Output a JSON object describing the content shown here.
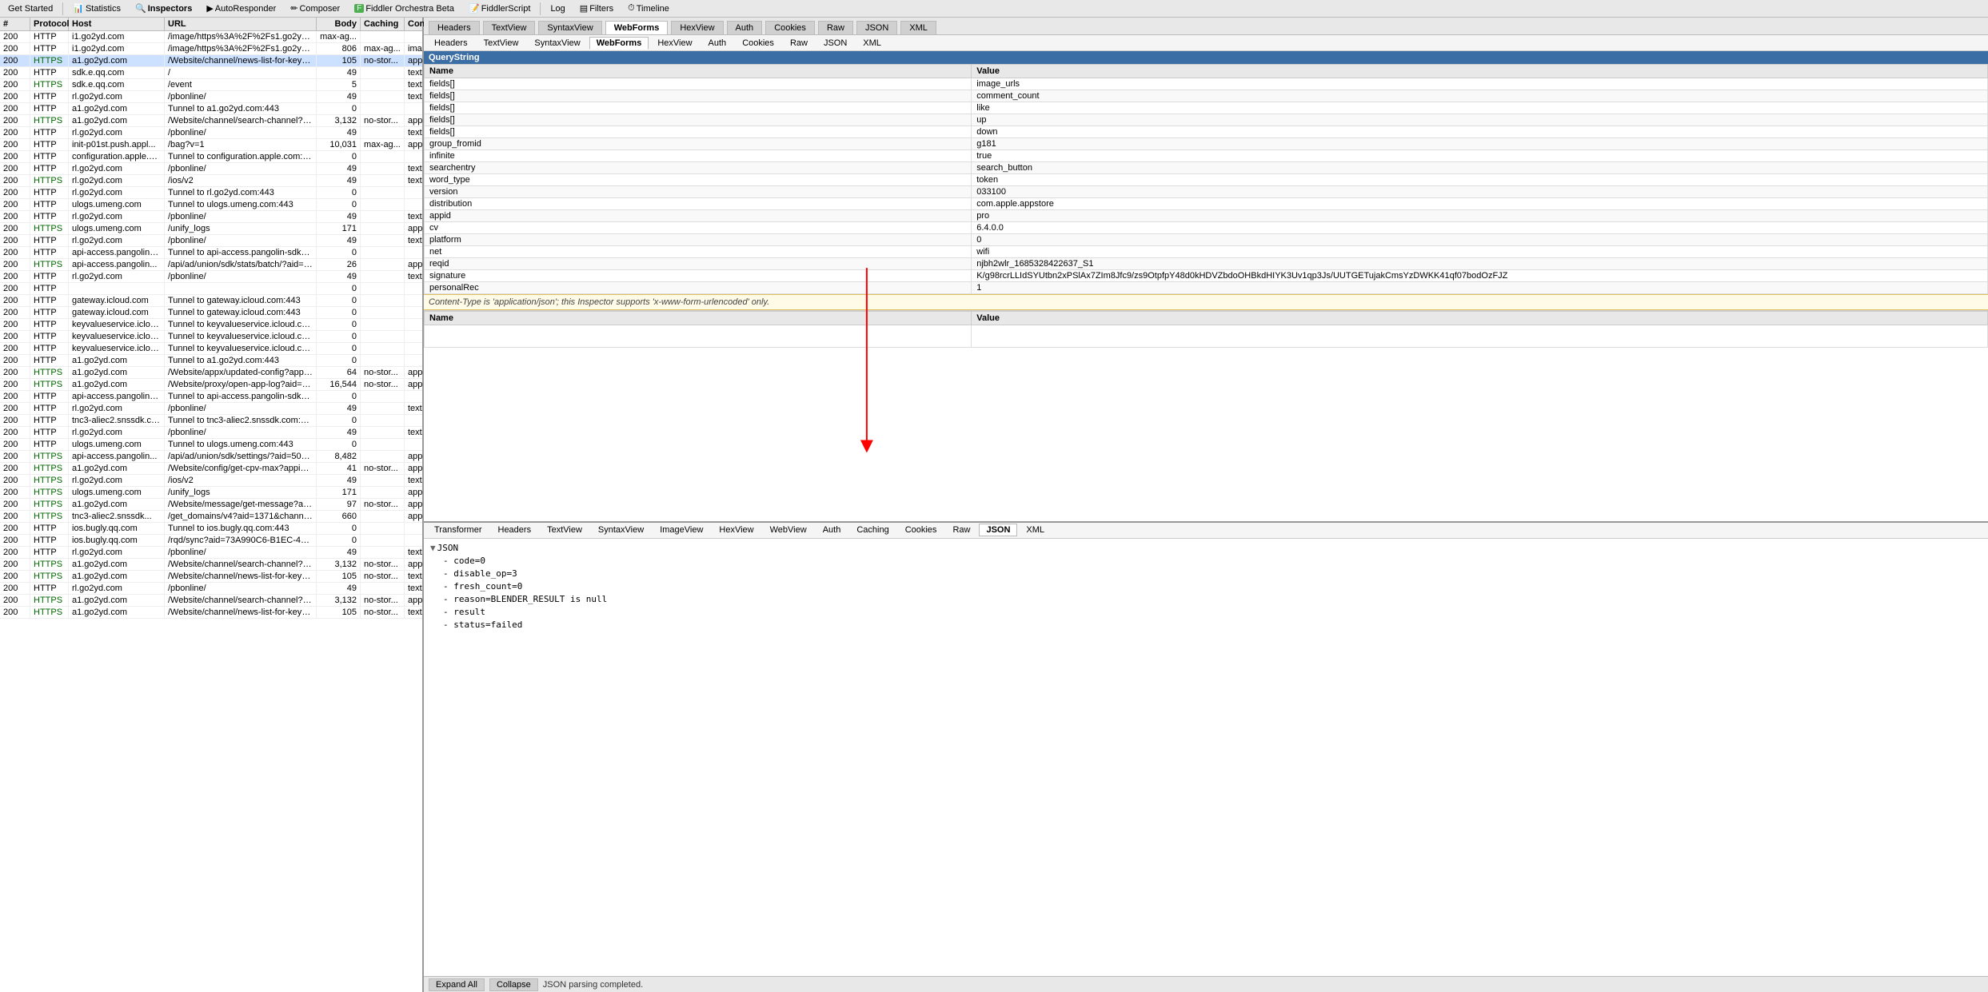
{
  "toolbar": {
    "get_started": "Get Started",
    "statistics": "Statistics",
    "inspectors": "Inspectors",
    "autoresponder": "AutoResponder",
    "composer": "Composer",
    "fiddler_orchestra": "Fiddler Orchestra Beta",
    "fiddler_script": "FiddlerScript",
    "log": "Log",
    "filters": "Filters",
    "timeline": "Timeline"
  },
  "traffic_columns": {
    "result": "#",
    "protocol": "Protocol",
    "host": "Host",
    "url": "URL",
    "body": "Body",
    "caching": "Caching",
    "content_type": "Content-Ty"
  },
  "traffic_rows": [
    {
      "result": "200",
      "protocol": "HTTP",
      "host": "i1.go2yd.com",
      "url": "/image/https%3A%2F%2Fs1.go2yd.com%2Fget-i...",
      "body": "max-ag...",
      "caching": "",
      "content_type": ""
    },
    {
      "result": "200",
      "protocol": "HTTP",
      "host": "i1.go2yd.com",
      "url": "/image/https%3A%2F%2Fs1.go2yd.com%2Fget-i...",
      "body": "806",
      "caching": "max-ag...",
      "content_type": "image/web"
    },
    {
      "result": "200",
      "protocol": "HTTPS",
      "host": "a1.go2yd.com",
      "url": "/Website/channel/news-list-for-keyword?cend=30&...",
      "body": "105",
      "caching": "no-stor...",
      "content_type": "application,"
    },
    {
      "result": "200",
      "protocol": "HTTP",
      "host": "sdk.e.qq.com",
      "url": "/",
      "body": "49",
      "caching": "",
      "content_type": "text/plain;"
    },
    {
      "result": "200",
      "protocol": "HTTPS",
      "host": "sdk.e.qq.com",
      "url": "/event",
      "body": "5",
      "caching": "",
      "content_type": "text/plain;"
    },
    {
      "result": "200",
      "protocol": "HTTP",
      "host": "rl.go2yd.com",
      "url": "/pbonline/",
      "body": "49",
      "caching": "",
      "content_type": "text/plain;"
    },
    {
      "result": "200",
      "protocol": "HTTP",
      "host": "a1.go2yd.com",
      "url": "Tunnel to a1.go2yd.com:443",
      "body": "0",
      "caching": "",
      "content_type": ""
    },
    {
      "result": "200",
      "protocol": "HTTPS",
      "host": "a1.go2yd.com",
      "url": "/Website/channel/search-channel?appid=pro&cv=6...",
      "body": "3,132",
      "caching": "no-stor...",
      "content_type": "application,"
    },
    {
      "result": "200",
      "protocol": "HTTP",
      "host": "rl.go2yd.com",
      "url": "/pbonline/",
      "body": "49",
      "caching": "",
      "content_type": "text/plain;"
    },
    {
      "result": "200",
      "protocol": "HTTP",
      "host": "init-p01st.push.appl...",
      "url": "/bag?v=1",
      "body": "10,031",
      "caching": "max-ag...",
      "content_type": "application,"
    },
    {
      "result": "200",
      "protocol": "HTTP",
      "host": "configuration.apple.com",
      "url": "Tunnel to configuration.apple.com:443",
      "body": "0",
      "caching": "",
      "content_type": ""
    },
    {
      "result": "200",
      "protocol": "HTTP",
      "host": "rl.go2yd.com",
      "url": "/pbonline/",
      "body": "49",
      "caching": "",
      "content_type": "text/plain;"
    },
    {
      "result": "200",
      "protocol": "HTTPS",
      "host": "rl.go2yd.com",
      "url": "/ios/v2",
      "body": "49",
      "caching": "",
      "content_type": "text/plain;"
    },
    {
      "result": "200",
      "protocol": "HTTP",
      "host": "rl.go2yd.com",
      "url": "Tunnel to rl.go2yd.com:443",
      "body": "0",
      "caching": "",
      "content_type": ""
    },
    {
      "result": "200",
      "protocol": "HTTP",
      "host": "ulogs.umeng.com",
      "url": "Tunnel to ulogs.umeng.com:443",
      "body": "0",
      "caching": "",
      "content_type": ""
    },
    {
      "result": "200",
      "protocol": "HTTP",
      "host": "rl.go2yd.com",
      "url": "/pbonline/",
      "body": "49",
      "caching": "",
      "content_type": "text/plain;"
    },
    {
      "result": "200",
      "protocol": "HTTPS",
      "host": "ulogs.umeng.com",
      "url": "/unify_logs",
      "body": "171",
      "caching": "",
      "content_type": "application,"
    },
    {
      "result": "200",
      "protocol": "HTTP",
      "host": "rl.go2yd.com",
      "url": "/pbonline/",
      "body": "49",
      "caching": "",
      "content_type": "text/plain;"
    },
    {
      "result": "200",
      "protocol": "HTTP",
      "host": "api-access.pangolin-sdk-toutiao.com",
      "url": "Tunnel to api-access.pangolin-sdk-toutiao.com:443",
      "body": "0",
      "caching": "",
      "content_type": ""
    },
    {
      "result": "200",
      "protocol": "HTTPS",
      "host": "api-access.pangolin...",
      "url": "/api/ad/union/sdk/stats/batch/?aid=5000546&versi...",
      "body": "26",
      "caching": "",
      "content_type": "application,"
    },
    {
      "result": "200",
      "protocol": "HTTP",
      "host": "rl.go2yd.com",
      "url": "/pbonline/",
      "body": "49",
      "caching": "",
      "content_type": "text/plain;"
    },
    {
      "result": "200",
      "protocol": "HTTP",
      "host": "",
      "url": "",
      "body": "0",
      "caching": "",
      "content_type": ""
    },
    {
      "result": "200",
      "protocol": "HTTP",
      "host": "gateway.icloud.com",
      "url": "Tunnel to gateway.icloud.com:443",
      "body": "0",
      "caching": "",
      "content_type": ""
    },
    {
      "result": "200",
      "protocol": "HTTP",
      "host": "gateway.icloud.com",
      "url": "Tunnel to gateway.icloud.com:443",
      "body": "0",
      "caching": "",
      "content_type": ""
    },
    {
      "result": "200",
      "protocol": "HTTP",
      "host": "keyvalueservice.icloud.com.cn",
      "url": "Tunnel to keyvalueservice.icloud.com.cn:443",
      "body": "0",
      "caching": "",
      "content_type": ""
    },
    {
      "result": "200",
      "protocol": "HTTP",
      "host": "keyvalueservice.icloud.com.cn",
      "url": "Tunnel to keyvalueservice.icloud.com.cn:443",
      "body": "0",
      "caching": "",
      "content_type": ""
    },
    {
      "result": "200",
      "protocol": "HTTP",
      "host": "keyvalueservice.icloud.com.cn",
      "url": "Tunnel to keyvalueservice.icloud.com.cn:443",
      "body": "0",
      "caching": "",
      "content_type": ""
    },
    {
      "result": "200",
      "protocol": "HTTP",
      "host": "a1.go2yd.com",
      "url": "Tunnel to a1.go2yd.com:443",
      "body": "0",
      "caching": "",
      "content_type": ""
    },
    {
      "result": "200",
      "protocol": "HTTPS",
      "host": "a1.go2yd.com",
      "url": "/Website/appx/updated-config?appid=pro&cv=6.4...",
      "body": "64",
      "caching": "no-stor...",
      "content_type": "application,"
    },
    {
      "result": "200",
      "protocol": "HTTPS",
      "host": "a1.go2yd.com",
      "url": "/Website/proxy/open-app-log?aid=-1&appid=pro&c...",
      "body": "16,544",
      "caching": "no-stor...",
      "content_type": "application,"
    },
    {
      "result": "200",
      "protocol": "HTTP",
      "host": "api-access.pangolin-sdk-toutiao.com",
      "url": "Tunnel to api-access.pangolin-sdk-toutiao.com:443",
      "body": "0",
      "caching": "",
      "content_type": ""
    },
    {
      "result": "200",
      "protocol": "HTTP",
      "host": "rl.go2yd.com",
      "url": "/pbonline/",
      "body": "49",
      "caching": "",
      "content_type": "text/plain;"
    },
    {
      "result": "200",
      "protocol": "HTTP",
      "host": "tnc3-aliec2.snssdk.com",
      "url": "Tunnel to tnc3-aliec2.snssdk.com:443",
      "body": "0",
      "caching": "",
      "content_type": ""
    },
    {
      "result": "200",
      "protocol": "HTTP",
      "host": "rl.go2yd.com",
      "url": "/pbonline/",
      "body": "49",
      "caching": "",
      "content_type": "text/plain;"
    },
    {
      "result": "200",
      "protocol": "HTTP",
      "host": "ulogs.umeng.com",
      "url": "Tunnel to ulogs.umeng.com:443",
      "body": "0",
      "caching": "",
      "content_type": ""
    },
    {
      "result": "200",
      "protocol": "HTTPS",
      "host": "api-access.pangolin...",
      "url": "/api/ad/union/sdk/settings/?aid=5000546&version_...",
      "body": "8,482",
      "caching": "",
      "content_type": "application,"
    },
    {
      "result": "200",
      "protocol": "HTTPS",
      "host": "a1.go2yd.com",
      "url": "/Website/config/get-cpv-max?appid=pro&cv=1.2...",
      "body": "41",
      "caching": "no-stor...",
      "content_type": "application,"
    },
    {
      "result": "200",
      "protocol": "HTTPS",
      "host": "rl.go2yd.com",
      "url": "/ios/v2",
      "body": "49",
      "caching": "",
      "content_type": "text/plain;"
    },
    {
      "result": "200",
      "protocol": "HTTPS",
      "host": "ulogs.umeng.com",
      "url": "/unify_logs",
      "body": "171",
      "caching": "",
      "content_type": "application,"
    },
    {
      "result": "200",
      "protocol": "HTTPS",
      "host": "a1.go2yd.com",
      "url": "/Website/message/get-message?appid=pro&cv=6...",
      "body": "97",
      "caching": "no-stor...",
      "content_type": "application,"
    },
    {
      "result": "200",
      "protocol": "HTTPS",
      "host": "tnc3-aliec2.snssdk...",
      "url": "/get_domains/v4?aid=1371&channel=app_store&3...",
      "body": "660",
      "caching": "",
      "content_type": "application,"
    },
    {
      "result": "200",
      "protocol": "HTTP",
      "host": "ios.bugly.qq.com",
      "url": "Tunnel to ios.bugly.qq.com:443",
      "body": "0",
      "caching": "",
      "content_type": ""
    },
    {
      "result": "200",
      "protocol": "HTTP",
      "host": "ios.bugly.qq.com",
      "url": "/rqd/sync?aid=73A990C6-B1EC-4844-973C-1A739...",
      "body": "0",
      "caching": "",
      "content_type": ""
    },
    {
      "result": "200",
      "protocol": "HTTP",
      "host": "rl.go2yd.com",
      "url": "/pbonline/",
      "body": "49",
      "caching": "",
      "content_type": "text/plain;"
    },
    {
      "result": "200",
      "protocol": "HTTPS",
      "host": "a1.go2yd.com",
      "url": "/Website/channel/search-channel?appid=pro&cv=6...",
      "body": "3,132",
      "caching": "no-stor...",
      "content_type": "application,"
    },
    {
      "result": "200",
      "protocol": "HTTPS",
      "host": "a1.go2yd.com",
      "url": "/Website/channel/news-list-for-keyword?cend=30&...",
      "body": "105",
      "caching": "no-stor...",
      "content_type": "text/plain;"
    },
    {
      "result": "200",
      "protocol": "HTTP",
      "host": "rl.go2yd.com",
      "url": "/pbonline/",
      "body": "49",
      "caching": "",
      "content_type": "text/plain;"
    },
    {
      "result": "200",
      "protocol": "HTTPS",
      "host": "a1.go2yd.com",
      "url": "/Website/channel/search-channel?appid=pro&cv=6...",
      "body": "3,132",
      "caching": "no-stor...",
      "content_type": "application,"
    },
    {
      "result": "200",
      "protocol": "HTTPS",
      "host": "a1.go2yd.com",
      "url": "/Website/channel/news-list-for-keyword?cend=30&...",
      "body": "105",
      "caching": "no-stor...",
      "content_type": "text/plain;"
    }
  ],
  "inspector_tabs": [
    "Headers",
    "TextView",
    "SyntaxView",
    "WebForms",
    "HexView",
    "Auth",
    "Cookies",
    "Raw",
    "JSON",
    "XML"
  ],
  "active_inspector_tab": "WebForms",
  "qs_label": "QueryString",
  "qs_headers": [
    "Name",
    "Value"
  ],
  "qs_rows": [
    {
      "name": "fields[]",
      "value": "image_urls"
    },
    {
      "name": "fields[]",
      "value": "comment_count"
    },
    {
      "name": "fields[]",
      "value": "like"
    },
    {
      "name": "fields[]",
      "value": "up"
    },
    {
      "name": "fields[]",
      "value": "down"
    },
    {
      "name": "group_fromid",
      "value": "g181"
    },
    {
      "name": "infinite",
      "value": "true"
    },
    {
      "name": "searchentry",
      "value": "search_button"
    },
    {
      "name": "word_type",
      "value": "token"
    },
    {
      "name": "version",
      "value": "033100"
    },
    {
      "name": "distribution",
      "value": "com.apple.appstore"
    },
    {
      "name": "appid",
      "value": "pro"
    },
    {
      "name": "cv",
      "value": "6.4.0.0"
    },
    {
      "name": "platform",
      "value": "0"
    },
    {
      "name": "net",
      "value": "wifi"
    },
    {
      "name": "reqid",
      "value": "njbh2wlr_1685328422637_S1"
    },
    {
      "name": "signature",
      "value": "K/g98rcrLLIdSYUtbn2xPSlAx7ZIm8Jfc9/zs9OtpfpY48d0kHDVZbdoOHBkdHIYK3Uv1qp3Js/UUTGETujakCmsYzDWKK41qf07bodOzFJZ"
    },
    {
      "name": "personalRec",
      "value": "1"
    }
  ],
  "ct_message": "Content-Type is 'application/json'; this Inspector supports 'x-www-form-urlencoded' only.",
  "bottom_nv_headers": [
    "Name",
    "Value"
  ],
  "response_tabs": [
    "Transformer",
    "Headers",
    "TextView",
    "SyntaxView",
    "ImageView",
    "HexView",
    "WebView",
    "Auth",
    "Caching",
    "Cookies",
    "Raw",
    "JSON",
    "XML"
  ],
  "active_response_tab": "JSON",
  "json_tree": {
    "root": "JSON",
    "items": [
      {
        "key": "code=0",
        "indent": 1
      },
      {
        "key": "disable_op=3",
        "indent": 1
      },
      {
        "key": "fresh_count=0",
        "indent": 1
      },
      {
        "key": "reason=BLENDER_RESULT is null",
        "indent": 1
      },
      {
        "key": "result",
        "indent": 1
      },
      {
        "key": "status=failed",
        "indent": 1
      }
    ]
  },
  "bottom_bar": {
    "expand_all": "Expand All",
    "collapse": "Collapse",
    "status": "JSON parsing completed."
  }
}
